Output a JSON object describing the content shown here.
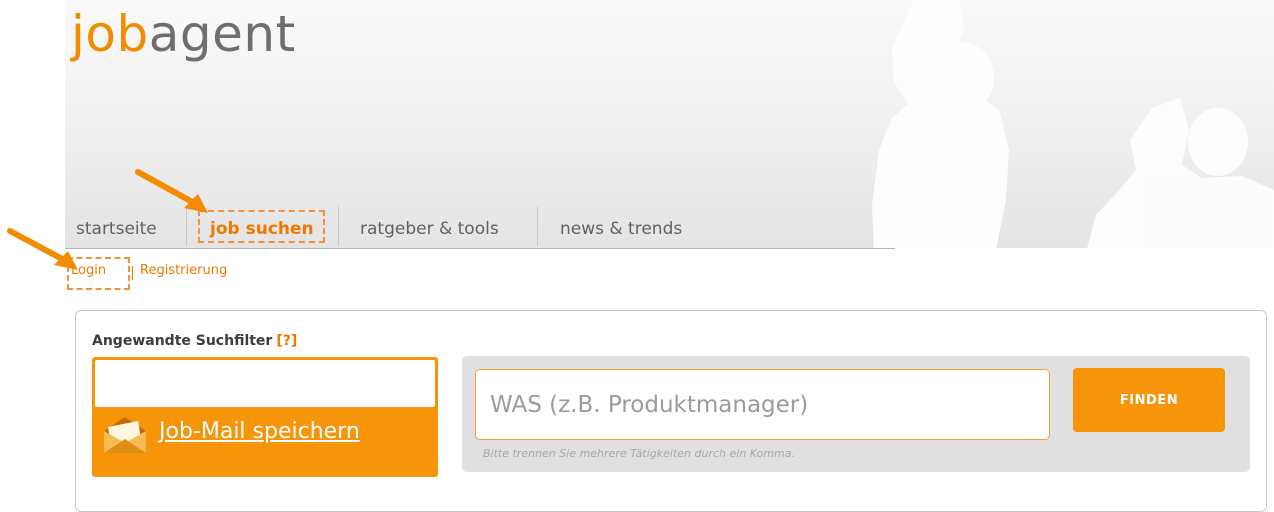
{
  "logo": {
    "part1": "job",
    "part2": "agent"
  },
  "nav": {
    "tabs": [
      {
        "label": "startseite"
      },
      {
        "label": "job suchen"
      },
      {
        "label": "ratgeber & tools"
      },
      {
        "label": "news & trends"
      }
    ]
  },
  "auth": {
    "login": "Login",
    "register": "Registrierung"
  },
  "filters": {
    "title": "Angewandte Suchfilter",
    "help": "[?]"
  },
  "jobmail": {
    "label": "Job-Mail speichern"
  },
  "search": {
    "placeholder": "WAS (z.B. Produktmanager)",
    "value": "",
    "hint": "Bitte trennen Sie mehrere Tätigkeiten durch ein Komma.",
    "button": "FINDEN"
  },
  "colors": {
    "accent": "#f7950a",
    "nav_active": "#f07800",
    "text": "#616161"
  }
}
